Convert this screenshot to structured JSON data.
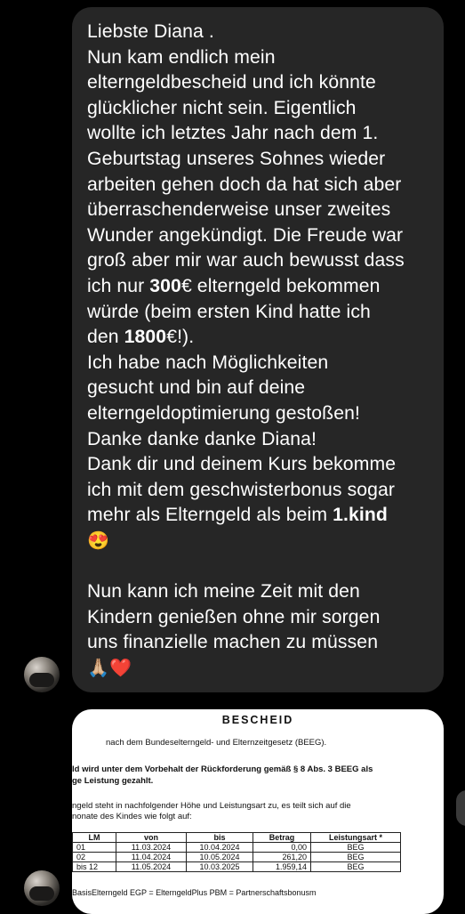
{
  "message": {
    "lines": [
      {
        "t": "Liebste Diana ."
      },
      {
        "t": "Nun kam endlich mein"
      },
      {
        "t": "elterngeldbescheid und ich könnte"
      },
      {
        "t": "glücklicher nicht sein. Eigentlich"
      },
      {
        "t": "wollte ich letztes Jahr nach dem 1."
      },
      {
        "t": "Geburtstag unseres Sohnes wieder"
      },
      {
        "t": "arbeiten gehen doch da hat sich aber"
      },
      {
        "t": "überraschenderweise unser zweites"
      },
      {
        "t": "Wunder angekündigt. Die Freude war"
      },
      {
        "t": "groß aber mir war auch bewusst dass"
      },
      {
        "pre": "ich nur ",
        "bold": "300",
        "post": "€ elterngeld bekommen"
      },
      {
        "t": "würde (beim ersten Kind hatte ich"
      },
      {
        "pre": "den ",
        "bold": "1800",
        "post": "€!)."
      },
      {
        "t": "Ich habe nach Möglichkeiten"
      },
      {
        "t": "gesucht und bin auf deine"
      },
      {
        "t": "elterngeldoptimierung gestoßen!"
      },
      {
        "t": "Danke danke danke Diana!"
      },
      {
        "t": "Dank dir und deinem Kurs bekomme"
      },
      {
        "t": "ich mit dem geschwisterbonus sogar"
      },
      {
        "pre": "mehr als Elterngeld als beim ",
        "bold": "1.kind",
        "post": ""
      },
      {
        "emoji": "😍"
      },
      {
        "gap": true
      },
      {
        "t": "Nun kann ich meine Zeit mit den"
      },
      {
        "t": "Kindern genießen ohne mir sorgen"
      },
      {
        "t": "uns finanzielle machen zu müssen"
      },
      {
        "emoji2": "🙏🏼",
        "heart": "❤️"
      }
    ]
  },
  "document": {
    "title": "BESCHEID",
    "subtitle": "nach dem Bundeselterngeld- und Elternzeitgesetz (BEEG).",
    "bold_line_1": "ld wird unter dem Vorbehalt der Rückforderung gemäß § 8 Abs. 3 BEEG als",
    "bold_line_2": "ge Leistung gezahlt.",
    "text_line_1": "ngeld steht in nachfolgender Höhe und Leistungsart zu, es teilt sich auf die",
    "text_line_2": "nonate des Kindes wie folgt auf:",
    "table_headers": [
      "LM",
      "von",
      "bis",
      "Betrag",
      "Leistungsart *"
    ],
    "table_rows": [
      [
        "01",
        "11.03.2024",
        "10.04.2024",
        "0,00",
        "BEG"
      ],
      [
        "02",
        "11.04.2024",
        "10.05.2024",
        "261,20",
        "BEG"
      ],
      [
        "bis 12",
        "11.05.2024",
        "10.03.2025",
        "1.959,14",
        "BEG"
      ]
    ],
    "footer": "BasisElterngeld        EGP = ElterngeldPlus              PBM = Partnerschaftsbonusm"
  }
}
